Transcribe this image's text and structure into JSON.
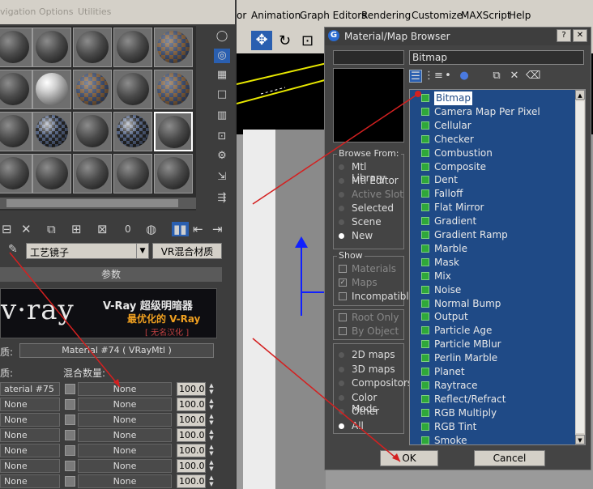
{
  "left_menu": {
    "items": [
      "vigation",
      "Options",
      "Utilities"
    ]
  },
  "main_menu": {
    "items": [
      "or",
      "Animation",
      "Graph Editors",
      "Rendering",
      "Customize",
      "MAXScript",
      "Help"
    ]
  },
  "editor": {
    "material_name": "工艺镜子",
    "type_button": "VR混合材质",
    "rollout_title": "参数",
    "vray_logo": "v·ray",
    "vray_line1": "V-Ray 超级明暗器",
    "vray_line2": "最优化的 V-Ray",
    "vray_line3": "[ 无名汉化 ]",
    "base_label": "质:",
    "base_material": "Material #74  ( VRayMtl )",
    "header_left": "质:",
    "header_right": "混合数量:",
    "rows": [
      {
        "label": "aterial #75",
        "map": "None",
        "amount": "100.0"
      },
      {
        "label": "None",
        "map": "None",
        "amount": "100.0"
      },
      {
        "label": "None",
        "map": "None",
        "amount": "100.0"
      },
      {
        "label": "None",
        "map": "None",
        "amount": "100.0"
      },
      {
        "label": "None",
        "map": "None",
        "amount": "100.0"
      },
      {
        "label": "None",
        "map": "None",
        "amount": "100.0"
      },
      {
        "label": "None",
        "map": "None",
        "amount": "100.0"
      }
    ],
    "toolbar_label_0": "0"
  },
  "browser": {
    "title": "Material/Map Browser",
    "selected_name": "Bitmap",
    "browse_from_title": "Browse From:",
    "browse_from": [
      {
        "label": "Mtl Library",
        "on": false,
        "disabled": false
      },
      {
        "label": "Mtl Editor",
        "on": false,
        "disabled": false
      },
      {
        "label": "Active Slot",
        "on": false,
        "disabled": true
      },
      {
        "label": "Selected",
        "on": false,
        "disabled": false
      },
      {
        "label": "Scene",
        "on": false,
        "disabled": false
      },
      {
        "label": "New",
        "on": true,
        "disabled": false
      }
    ],
    "show_title": "Show",
    "show": [
      {
        "label": "Materials",
        "checked": false,
        "disabled": true
      },
      {
        "label": "Maps",
        "checked": true,
        "disabled": true
      },
      {
        "label": "Incompatible",
        "checked": false,
        "disabled": false
      }
    ],
    "options": [
      {
        "label": "Root Only",
        "checked": false,
        "disabled": true
      },
      {
        "label": "By Object",
        "checked": false,
        "disabled": true
      }
    ],
    "categories": [
      {
        "label": "2D maps",
        "on": false
      },
      {
        "label": "3D maps",
        "on": false
      },
      {
        "label": "Compositors",
        "on": false
      },
      {
        "label": "Color Mods",
        "on": false
      },
      {
        "label": "Other",
        "on": false
      },
      {
        "label": "All",
        "on": true
      }
    ],
    "maps": [
      "Bitmap",
      "Camera Map Per Pixel",
      "Cellular",
      "Checker",
      "Combustion",
      "Composite",
      "Dent",
      "Falloff",
      "Flat Mirror",
      "Gradient",
      "Gradient Ramp",
      "Marble",
      "Mask",
      "Mix",
      "Noise",
      "Normal Bump",
      "Output",
      "Particle Age",
      "Particle MBlur",
      "Perlin Marble",
      "Planet",
      "Raytrace",
      "Reflect/Refract",
      "RGB Multiply",
      "RGB Tint",
      "Smoke"
    ],
    "selected_index": 0,
    "ok_label": "OK",
    "cancel_label": "Cancel"
  },
  "colors": {
    "list_bg": "#1f4a86",
    "map_icon": "#2fa83a",
    "annotation": "#d42020",
    "axis": "#1020ff"
  }
}
